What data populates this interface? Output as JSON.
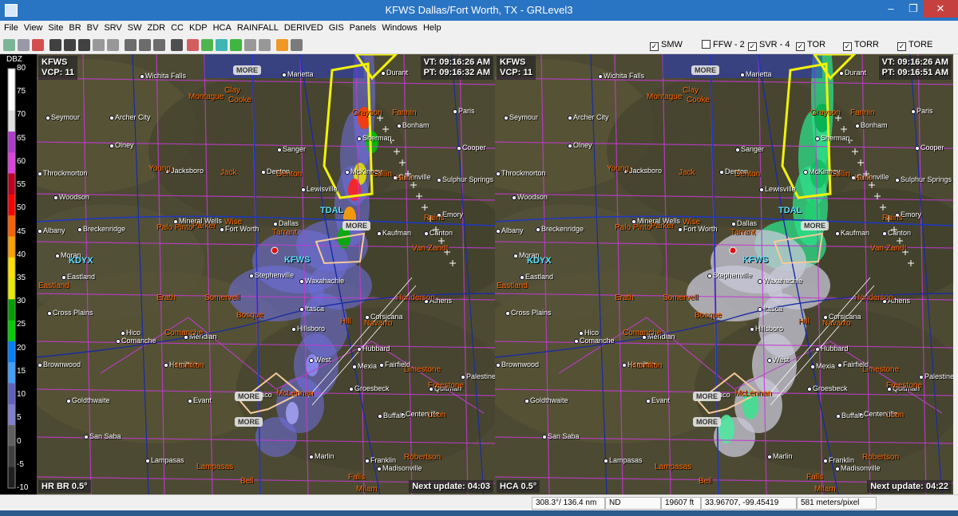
{
  "window": {
    "title": "KFWS Dallas/Fort Worth, TX - GRLevel3",
    "minimize": "–",
    "maximize": "❐",
    "close": "✕"
  },
  "menu": [
    "File",
    "View",
    "Site",
    "BR",
    "BV",
    "SRV",
    "SW",
    "ZDR",
    "CC",
    "KDP",
    "HCA",
    "RAINFALL",
    "DERIVED",
    "GIS",
    "Panels",
    "Windows",
    "Help"
  ],
  "warnings": [
    {
      "label": "SMW",
      "checked": true
    },
    {
      "label": "FFW - 2",
      "checked": false
    },
    {
      "label": "SVR - 4",
      "checked": true
    },
    {
      "label": "TOR",
      "checked": true
    },
    {
      "label": "TORR",
      "checked": true
    },
    {
      "label": "TORE",
      "checked": true
    }
  ],
  "legend": {
    "title": "DBZ",
    "ticks": [
      "80",
      "75",
      "70",
      "65",
      "60",
      "55",
      "50",
      "45",
      "40",
      "35",
      "30",
      "25",
      "20",
      "15",
      "10",
      "5",
      "0",
      "-5",
      "-10"
    ]
  },
  "left_pane": {
    "site": "KFWS",
    "vcp": "VCP: 11",
    "vt": "VT: 09:16:26 AM",
    "pt": "PT: 09:16:32 AM",
    "product": "HR BR 0.5°",
    "next_update": "Next update: 04:03",
    "more": "MORE"
  },
  "right_pane": {
    "site": "KFWS",
    "vcp": "VCP: 11",
    "vt": "VT: 09:16:26 AM",
    "pt": "PT: 09:16:51 AM",
    "product": "HCA 0.5°",
    "next_update": "Next update: 04:22",
    "more": "MORE"
  },
  "cities": [
    "Wichita Falls",
    "Marietta",
    "Durant",
    "Sherman",
    "Bonham",
    "Paris",
    "Seymour",
    "Archer City",
    "Olney",
    "Sanger",
    "Cooper",
    "Throckmorton",
    "Jacksboro",
    "McKinney",
    "Greenville",
    "Sulphur Springs",
    "Woodson",
    "Denton",
    "Lewisville",
    "Emory",
    "Albany",
    "Breckenridge",
    "Mineral Wells",
    "Fort Worth",
    "Dallas",
    "Kaufman",
    "Canton",
    "Moran",
    "Eastland",
    "Stephenville",
    "Waxahachie",
    "Cross Plains",
    "Itasca",
    "Hillsboro",
    "Corsicana",
    "Athens",
    "Hico",
    "Meridian",
    "Comanche",
    "Hubbard",
    "Brownwood",
    "Hamilton",
    "West",
    "Mexia",
    "Fairfield",
    "Goldthwaite",
    "Evant",
    "Waco",
    "Groesbeck",
    "Buffalo",
    "Marlin",
    "Centerville",
    "San Saba",
    "Lampasas",
    "Franklin",
    "Madisonville",
    "Quitman",
    "Palestine"
  ],
  "counties": [
    "Clay",
    "Montague",
    "Cooke",
    "Grayson",
    "Fannin",
    "Young",
    "Jack",
    "Wise",
    "Denton",
    "Collin",
    "Hunt",
    "Palo Pinto",
    "Parker",
    "Tarrant",
    "Rains",
    "Van Zandt",
    "Eastland",
    "Erath",
    "Somervell",
    "Hill",
    "Navarro",
    "Henderson",
    "Comanche",
    "Bosque",
    "Hamilton",
    "McLennan",
    "Limestone",
    "Freestone",
    "Leon",
    "Lampasas",
    "Bell",
    "Falls",
    "Robertson",
    "Milam"
  ],
  "sites": [
    "KDYX",
    "KFWS",
    "TDAL"
  ],
  "status": {
    "azimuth": "308.3°/ 136.4 nm",
    "value": "ND",
    "height": "19607 ft",
    "coords": "33.96707, -99.45419",
    "resolution": "581 meters/pixel"
  },
  "colors": {
    "map_bg": "#4d4a33",
    "county_lines": "#c23cd1",
    "warning_tor": "#f2f20a",
    "warning_svr": "#f5c99a",
    "titlebar": "#2a74c4"
  }
}
